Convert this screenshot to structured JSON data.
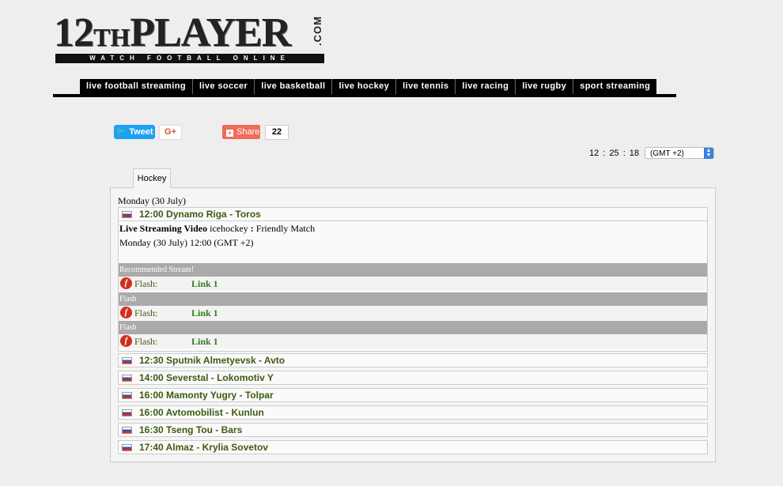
{
  "logo": {
    "main": "12",
    "th": "TH",
    "rest": "PLAYER",
    "com": ".COM",
    "tagline": "WATCH FOOTBALL ONLINE"
  },
  "nav": [
    "live football streaming",
    "live soccer",
    "live basketball",
    "live hockey",
    "live tennis",
    "live racing",
    "live rugby",
    "sport streaming"
  ],
  "social": {
    "tweet": "Tweet",
    "gplus": "G+",
    "share": "Share",
    "share_count": "22"
  },
  "clock": {
    "time": "12 : 25 : 18",
    "timezone": "(GMT +2)"
  },
  "tab": "Hockey",
  "day_header": "Monday (30 July)",
  "matches": [
    {
      "time": "12:00",
      "name": "Dynamo Riga - Toros"
    },
    {
      "time": "12:30",
      "name": "Sputnik Almetyevsk - Avto"
    },
    {
      "time": "14:00",
      "name": "Severstal - Lokomotiv Y"
    },
    {
      "time": "16:00",
      "name": "Mamonty Yugry - Tolpar"
    },
    {
      "time": "16:00",
      "name": "Avtomobilist - Kunlun"
    },
    {
      "time": "16:30",
      "name": "Tseng Tou - Bars"
    },
    {
      "time": "17:40",
      "name": "Almaz - Krylia Sovetov"
    }
  ],
  "details": {
    "live_label": "Live Streaming Video",
    "sport": " icehockey ",
    "sep": ":",
    "type": " Friendly Match",
    "when": "Monday (30 July) 12:00 (GMT +2)",
    "bars": [
      "Recommended Stream!",
      "Flash",
      "Flash"
    ],
    "links": [
      {
        "type": "Flash:",
        "link": "Link 1"
      },
      {
        "type": "Flash:",
        "link": "Link 1"
      },
      {
        "type": "Flash:",
        "link": "Link 1"
      }
    ]
  }
}
